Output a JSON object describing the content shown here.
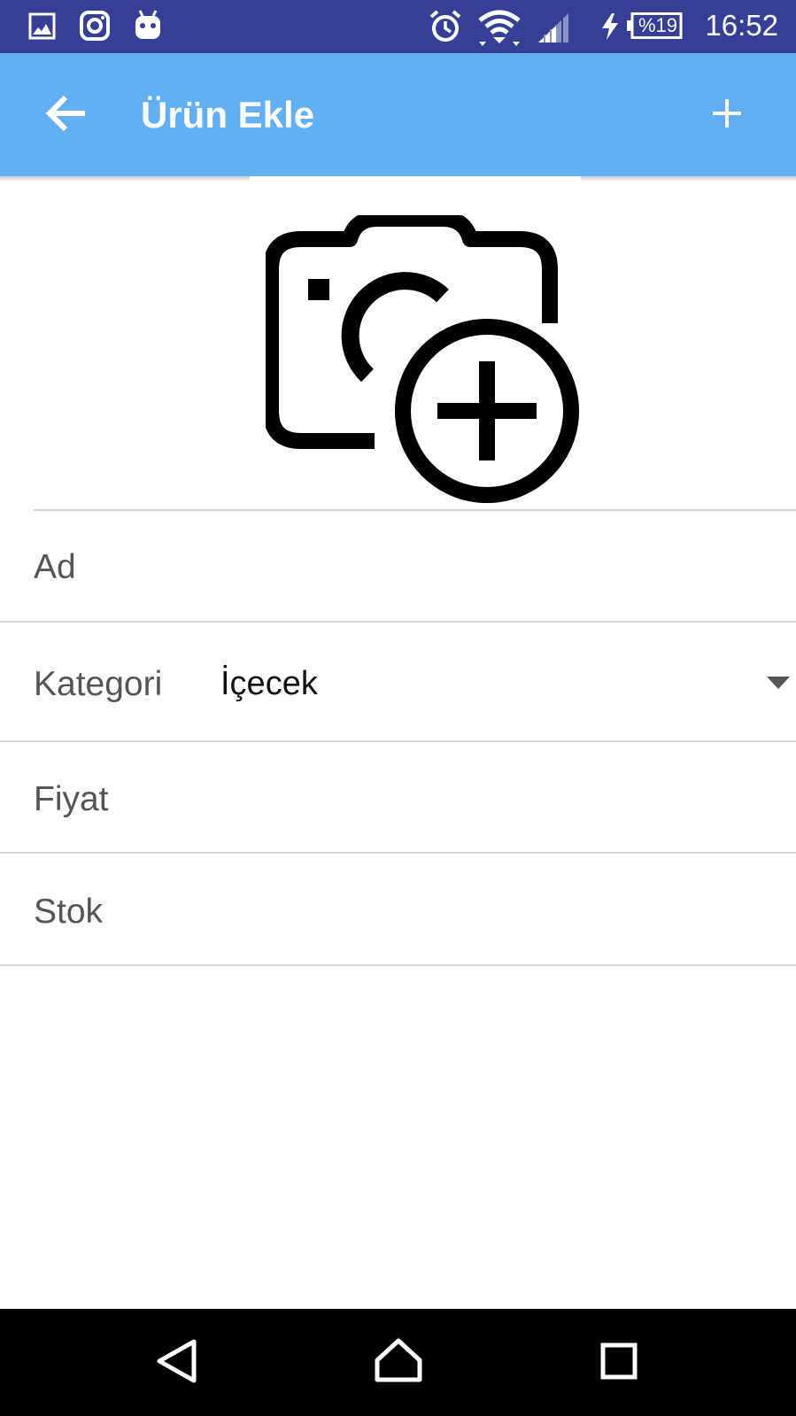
{
  "status_bar": {
    "time": "16:52",
    "battery": "%19",
    "background": "#343f95"
  },
  "app_bar": {
    "title": "Ürün Ekle",
    "back_icon": "arrow-back-icon",
    "add_icon": "plus-icon",
    "background": "#62aff4"
  },
  "photo": {
    "icon": "add-a-photo-icon"
  },
  "form": {
    "name_label": "Ad",
    "category_label": "Kategori",
    "category_value": "İçecek",
    "price_label": "Fiyat",
    "stock_label": "Stok"
  },
  "nav_bar": {
    "back_icon": "nav-back-icon",
    "home_icon": "nav-home-icon",
    "recents_icon": "nav-recents-icon"
  }
}
